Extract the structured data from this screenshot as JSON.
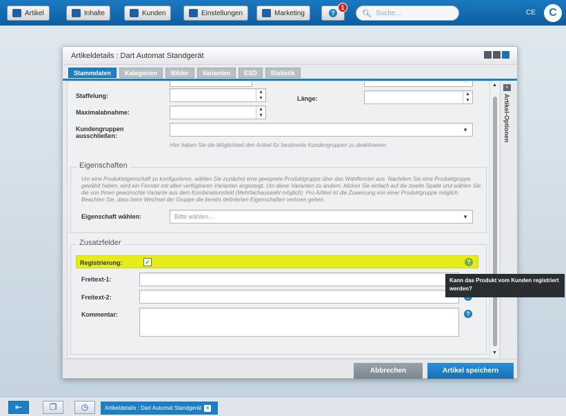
{
  "topbar": {
    "buttons": [
      "Artikel",
      "Inhalte",
      "Kunden",
      "Einstellungen",
      "Marketing"
    ],
    "notification_count": "1",
    "search_placeholder": "Suche...",
    "user_initials": "CE"
  },
  "window": {
    "title": "Artikeldetails : Dart Automat Standgerät",
    "tabs": [
      "Stammdaten",
      "Kategorien",
      "Bilder",
      "Varianten",
      "ESD",
      "Statistik"
    ],
    "active_tab": "Stammdaten"
  },
  "form": {
    "staffelung_label": "Staffelung:",
    "maximalabnahme_label": "Maximalabnahme:",
    "laenge_label": "Länge:",
    "kundengruppen_label": "Kundengruppen ausschließen:",
    "kundengruppen_hint": "Hier haben Sie die Möglichkeit den Artikel für bestimmte Kundengruppen zu deaktivieren."
  },
  "eigenschaften": {
    "legend": "Eigenschaften",
    "description": "Um eine Produkteigenschaft zu konfigurieren, wählen Sie zunächst eine geeignete Produktgruppe über das Wahlfenster aus. Nachdem Sie eine Produktgruppe gewählt haben, wird ein Fenster mit allen verfügbaren Varianten angezeigt. Um diese Varianten zu ändern, klicken Sie einfach auf die zweite Spalte und wählen Sie die von Ihnen gewünschte Variante aus dem Kombinationsfeld (Mehrfachauswahl möglich). Pro Artikel ist die Zuweisung von einer Produktgruppe möglich. Beachten Sie, dass beim Wechsel der Gruppe die bereits definierten Eigenschaften verloren gehen.",
    "select_label": "Eigenschaft wählen:",
    "select_placeholder": "Bitte wählen..."
  },
  "zusatzfelder": {
    "legend": "Zusatzfelder",
    "registrierung_label": "Registrierung:",
    "registrierung_checked": true,
    "freitext1_label": "Freitext-1:",
    "freitext2_label": "Freitext-2:",
    "kommentar_label": "Kommentar:",
    "tooltip": "Kann das Produkt vom Kunden registriert werden?"
  },
  "side_panel": {
    "label": "Artikel-Optionen"
  },
  "footer": {
    "cancel": "Abbrechen",
    "save": "Artikel speichern"
  },
  "taskbar": {
    "window_tab": "Artikeldetails : Dart Automat Standgerät"
  },
  "colors": {
    "accent": "#1d7ec4",
    "highlight": "#e6ec1c",
    "topbar": "#1b78bf"
  }
}
